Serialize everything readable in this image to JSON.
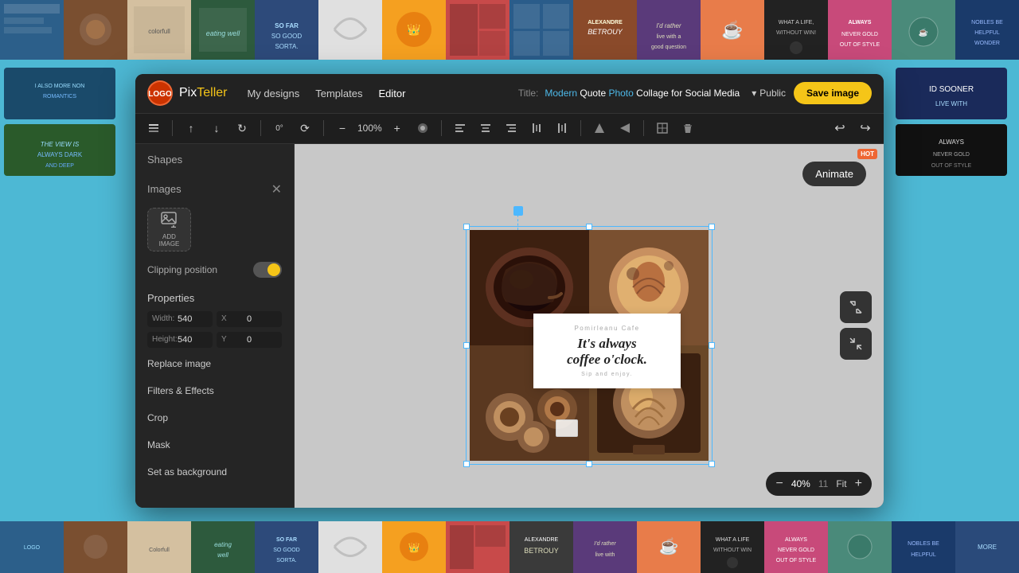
{
  "app": {
    "name_pix": "Pix",
    "name_teller": "Teller"
  },
  "navbar": {
    "my_designs": "My designs",
    "templates": "Templates",
    "editor": "Editor",
    "title_label": "Title:",
    "title_text": "Modern Quote Photo Collage for Social Media",
    "public_label": "Public",
    "save_button": "Save image"
  },
  "toolbar": {
    "zoom_value": "100%",
    "undo": "↩",
    "redo": "↪"
  },
  "left_panel": {
    "shapes_label": "Shapes",
    "images_label": "Images",
    "add_image_label": "ADD\nIMAGE",
    "clipping_label": "Clipping position",
    "properties_label": "Properties",
    "width_label": "Width:",
    "width_value": "540",
    "height_label": "Height:",
    "height_value": "540",
    "x_label": "X",
    "x_value": "0",
    "y_label": "Y",
    "y_value": "0",
    "replace_image": "Replace image",
    "filters_effects": "Filters & Effects",
    "crop": "Crop",
    "mask": "Mask",
    "set_as_background": "Set as background"
  },
  "canvas": {
    "cafe_name": "Pomirleanu Cafe",
    "main_quote_line1": "It's always",
    "main_quote_line2": "coffee o'clock.",
    "sub_text": "Sip and enjoy.",
    "animate_btn": "Animate",
    "hot_badge": "HOT"
  },
  "bottom_controls": {
    "zoom_out": "−",
    "zoom_value": "40%",
    "zoom_num": "11",
    "fit": "Fit",
    "zoom_in": "+"
  },
  "top_strip": [
    {
      "id": "ts1",
      "bg": "t1"
    },
    {
      "id": "ts2",
      "bg": "t2"
    },
    {
      "id": "ts3",
      "bg": "t3"
    },
    {
      "id": "ts4",
      "bg": "t4"
    },
    {
      "id": "ts5",
      "bg": "t5"
    },
    {
      "id": "ts6",
      "bg": "t6"
    },
    {
      "id": "ts7",
      "bg": "t7"
    },
    {
      "id": "ts8",
      "bg": "t8"
    },
    {
      "id": "ts9",
      "bg": "t9"
    },
    {
      "id": "ts10",
      "bg": "t10"
    },
    {
      "id": "ts11",
      "bg": "t11"
    },
    {
      "id": "ts12",
      "bg": "t12"
    },
    {
      "id": "ts13",
      "bg": "t13"
    },
    {
      "id": "ts14",
      "bg": "t14"
    },
    {
      "id": "ts15",
      "bg": "t15"
    },
    {
      "id": "ts16",
      "bg": "t16"
    }
  ]
}
